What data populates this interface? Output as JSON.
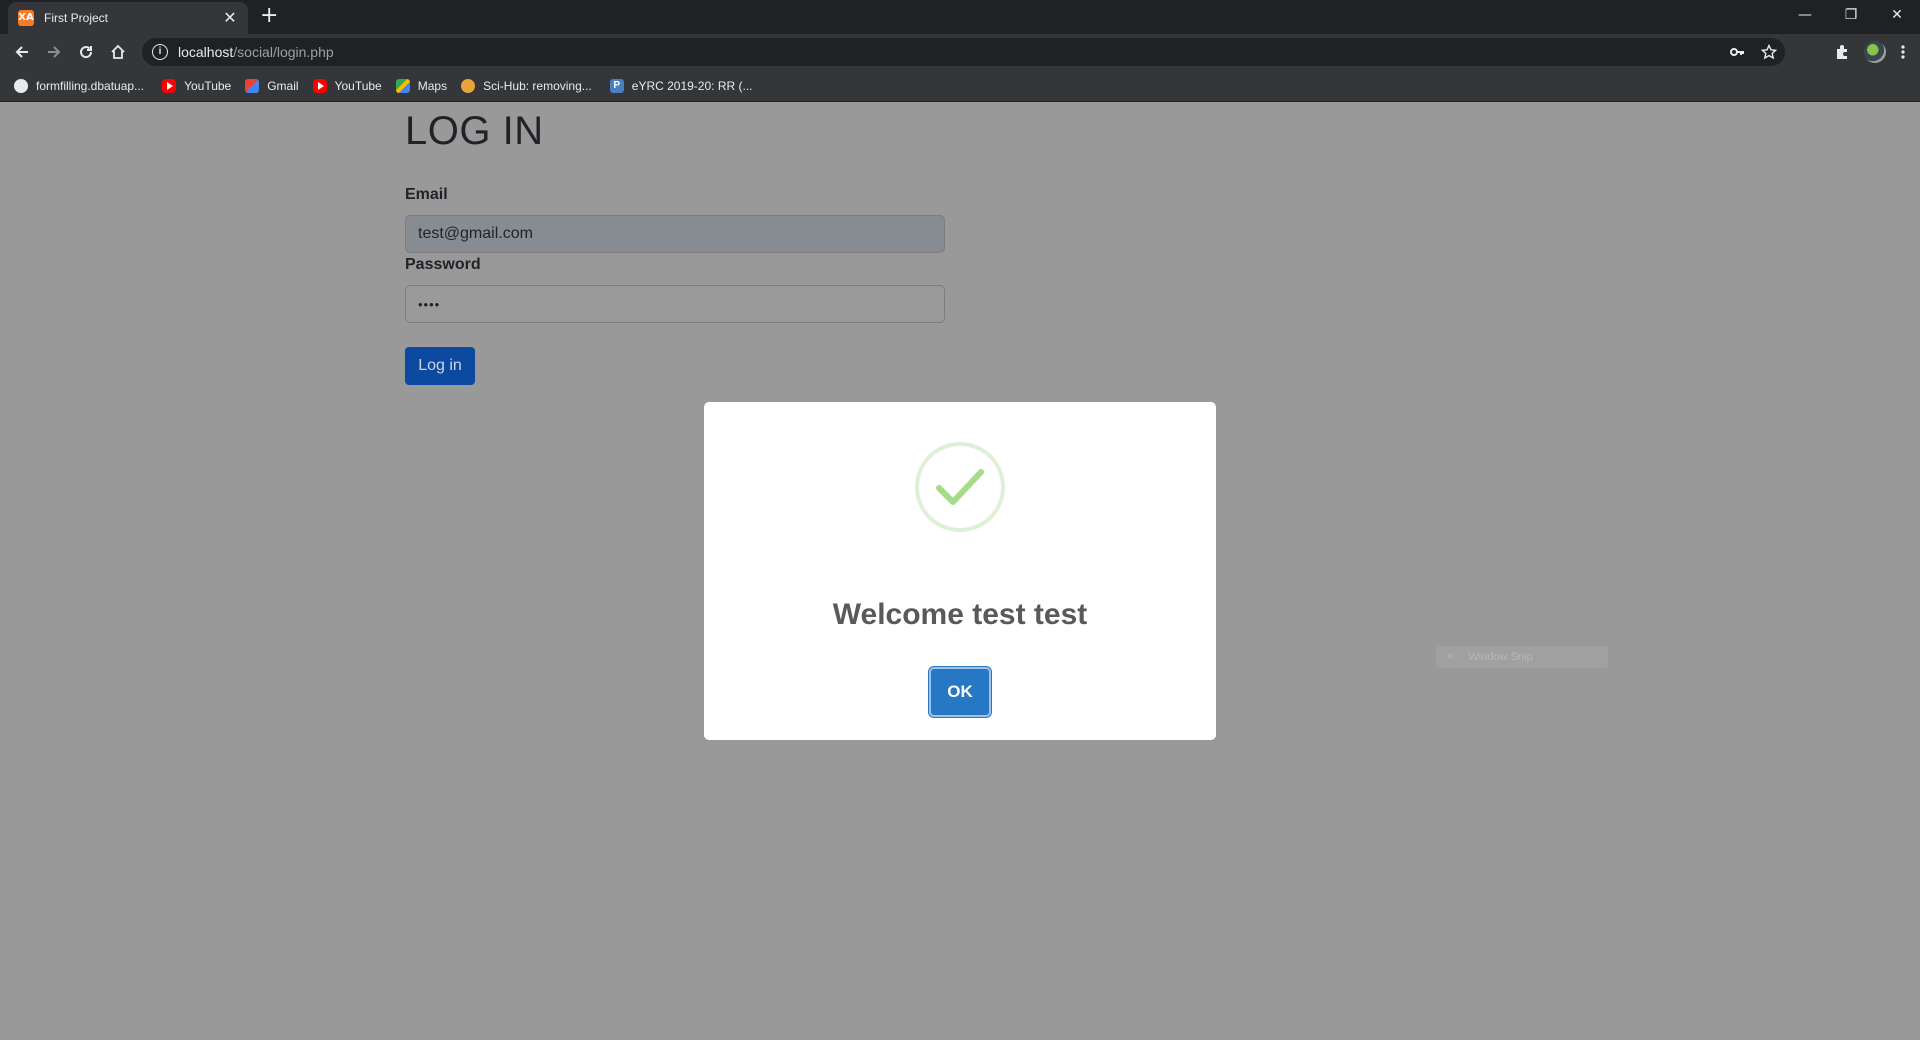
{
  "browser": {
    "tab": {
      "title": "First Project",
      "favicon_letters": "XA",
      "close_glyph": "✕"
    },
    "new_tab_glyph": "+",
    "window_controls": {
      "minimize": "—",
      "restore": "❐",
      "close": "✕"
    },
    "url": {
      "host": "localhost",
      "path": "/social/login.php"
    },
    "bookmarks": [
      {
        "label": "formfilling.dbatuap...",
        "icon": "globe-icon"
      },
      {
        "label": "YouTube",
        "icon": "youtube-icon"
      },
      {
        "label": "Gmail",
        "icon": "gmail-icon"
      },
      {
        "label": "YouTube",
        "icon": "youtube-icon"
      },
      {
        "label": "Maps",
        "icon": "maps-icon"
      },
      {
        "label": "Sci-Hub: removing...",
        "icon": "scihub-icon"
      },
      {
        "label": "eYRC 2019-20: RR (...",
        "icon": "p-icon",
        "icon_letter": "P"
      }
    ]
  },
  "page": {
    "title": "LOG IN",
    "email_label": "Email",
    "email_value": "test@gmail.com",
    "password_label": "Password",
    "password_value": "••••",
    "login_button": "Log in"
  },
  "modal": {
    "message": "Welcome test test",
    "ok_button": "OK"
  },
  "overlay_hint": {
    "text": "Window Snip",
    "glyph": "✕"
  },
  "colors": {
    "chrome_dark": "#202124",
    "chrome_toolbar": "#35363a",
    "page_overlay": "#999999",
    "primary_button": "#0b4aa0",
    "ok_button": "#2778c4",
    "success_green": "#a5dc86"
  }
}
